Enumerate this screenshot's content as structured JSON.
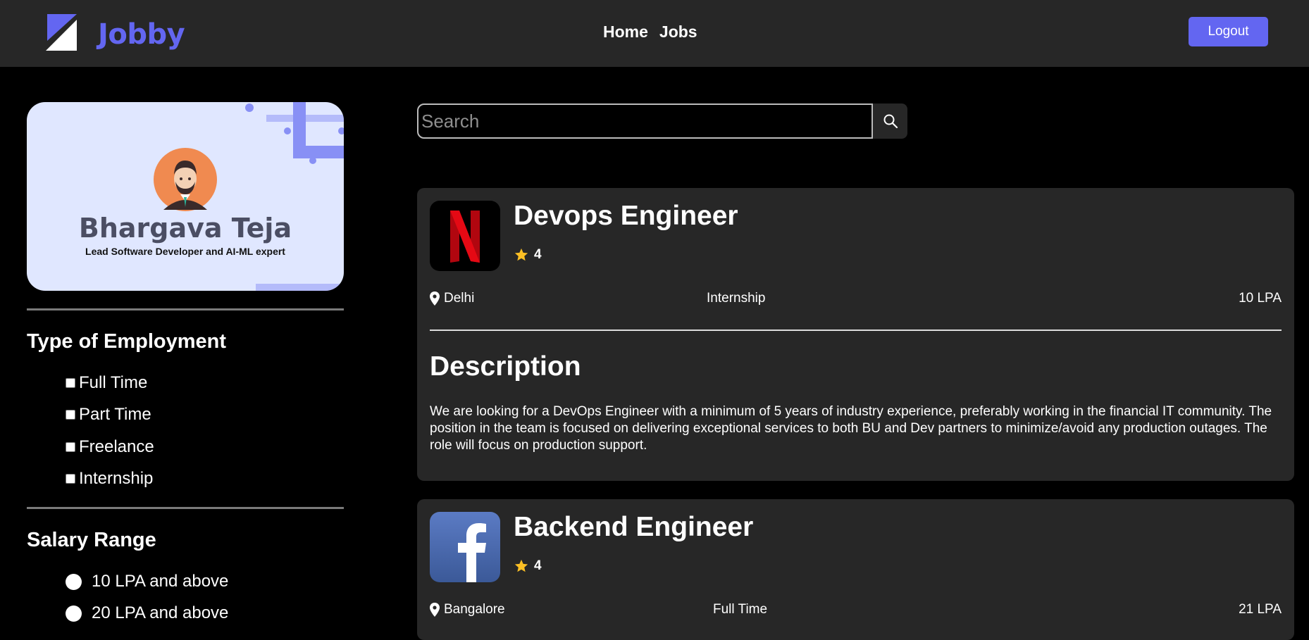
{
  "header": {
    "brand": "Jobby",
    "nav": [
      "Home",
      "Jobs"
    ],
    "logout_label": "Logout"
  },
  "profile": {
    "name": "Bhargava Teja",
    "bio": "Lead Software Developer and AI-ML expert"
  },
  "filters": {
    "employment_title": "Type of Employment",
    "employment_options": [
      "Full Time",
      "Part Time",
      "Freelance",
      "Internship"
    ],
    "salary_title": "Salary Range",
    "salary_options": [
      "10 LPA and above",
      "20 LPA and above"
    ]
  },
  "search": {
    "placeholder": "Search",
    "value": ""
  },
  "jobs": [
    {
      "title": "Devops Engineer",
      "company": "Netflix",
      "logo_icon": "netflix-logo",
      "rating": "4",
      "location": "Delhi",
      "employment_type": "Internship",
      "package": "10 LPA",
      "description_title": "Description",
      "description": "We are looking for a DevOps Engineer with a minimum of 5 years of industry experience, preferably working in the financial IT community. The position in the team is focused on delivering exceptional services to both BU and Dev partners to minimize/avoid any production outages. The role will focus on production support."
    },
    {
      "title": "Backend Engineer",
      "company": "Facebook",
      "logo_icon": "facebook-logo",
      "rating": "4",
      "location": "Bangalore",
      "employment_type": "Full Time",
      "package": "21 LPA"
    }
  ],
  "colors": {
    "accent": "#6366f1",
    "header_bg": "#272727",
    "card_bg": "#272727",
    "page_bg": "#000000",
    "star": "#fbbf24",
    "profile_bg": "#e0e7ff"
  }
}
